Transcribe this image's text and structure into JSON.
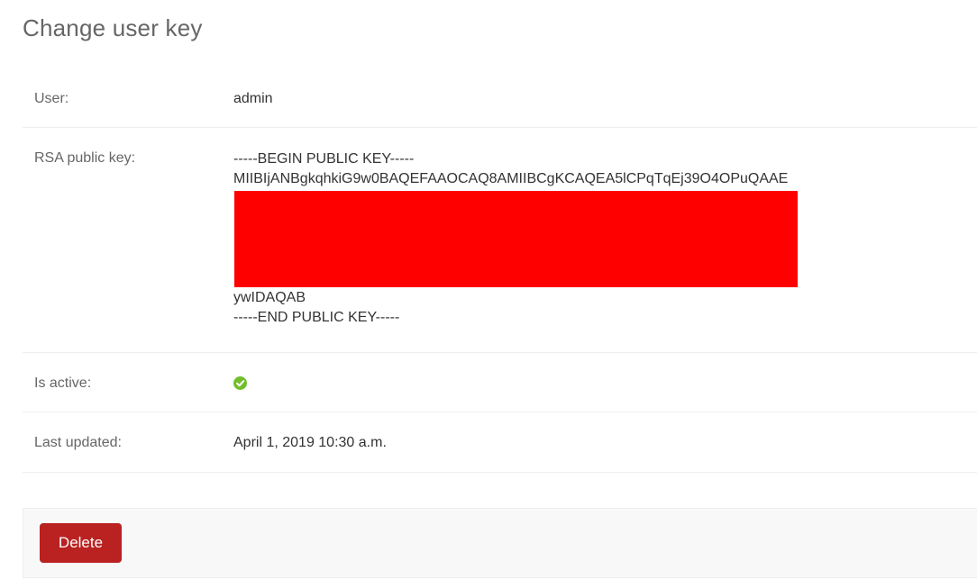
{
  "page": {
    "title": "Change user key"
  },
  "fields": {
    "user": {
      "label": "User:",
      "value": "admin"
    },
    "public_key": {
      "label": "RSA public key:",
      "lines": {
        "begin": "-----BEGIN PUBLIC KEY-----",
        "line1": "MIIBIjANBgkqhkiG9w0BAQEFAAOCAQ8AMIIBCgKCAQEA5lCPqTqEj39O4OPuQAAE",
        "line_last": "ywIDAQAB",
        "end": "-----END PUBLIC KEY-----"
      },
      "redaction_color": "#ff0000"
    },
    "is_active": {
      "label": "Is active:",
      "value": true,
      "icon": "check-circle-icon",
      "icon_color": "#70bf2b"
    },
    "last_updated": {
      "label": "Last updated:",
      "value": "April 1, 2019 10:30 a.m."
    }
  },
  "actions": {
    "delete_label": "Delete",
    "delete_color": "#ba2121"
  }
}
